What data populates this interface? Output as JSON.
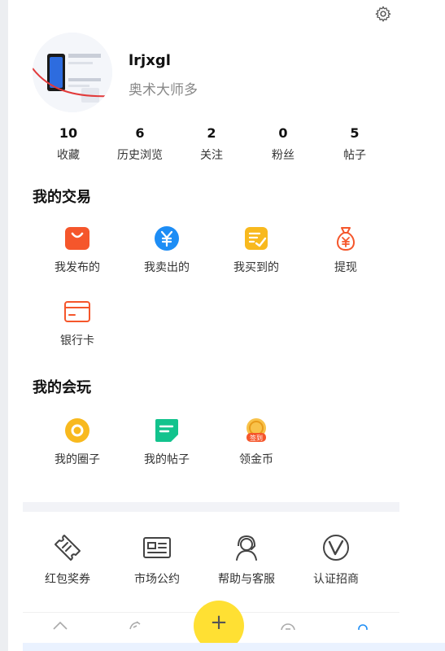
{
  "profile": {
    "username": "lrjxgl",
    "subtitle": "奥术大师多"
  },
  "stats": [
    {
      "value": "10",
      "label": "收藏"
    },
    {
      "value": "6",
      "label": "历史浏览"
    },
    {
      "value": "2",
      "label": "关注"
    },
    {
      "value": "0",
      "label": "粉丝"
    },
    {
      "value": "5",
      "label": "帖子"
    }
  ],
  "trade": {
    "title": "我的交易",
    "items": [
      {
        "label": "我发布的",
        "icon": "bag-icon"
      },
      {
        "label": "我卖出的",
        "icon": "yen-coin-icon"
      },
      {
        "label": "我买到的",
        "icon": "checklist-icon"
      },
      {
        "label": "提现",
        "icon": "money-bag-icon"
      },
      {
        "label": "银行卡",
        "icon": "bank-card-icon"
      }
    ]
  },
  "play": {
    "title": "我的会玩",
    "items": [
      {
        "label": "我的圈子",
        "icon": "circle-icon"
      },
      {
        "label": "我的帖子",
        "icon": "post-icon"
      },
      {
        "label": "领金币",
        "icon": "gold-coin-icon",
        "badge": "签到"
      }
    ]
  },
  "tools": [
    {
      "label": "红包奖券",
      "icon": "ticket-icon"
    },
    {
      "label": "市场公约",
      "icon": "id-card-icon"
    },
    {
      "label": "帮助与客服",
      "icon": "headset-icon"
    },
    {
      "label": "认证招商",
      "icon": "verified-icon"
    }
  ],
  "fab": {
    "label": "+"
  },
  "colors": {
    "orange": "#f5562b",
    "blue": "#1d8df5",
    "yellow": "#f8b91e",
    "green": "#12c38d",
    "fab": "#ffe033"
  }
}
